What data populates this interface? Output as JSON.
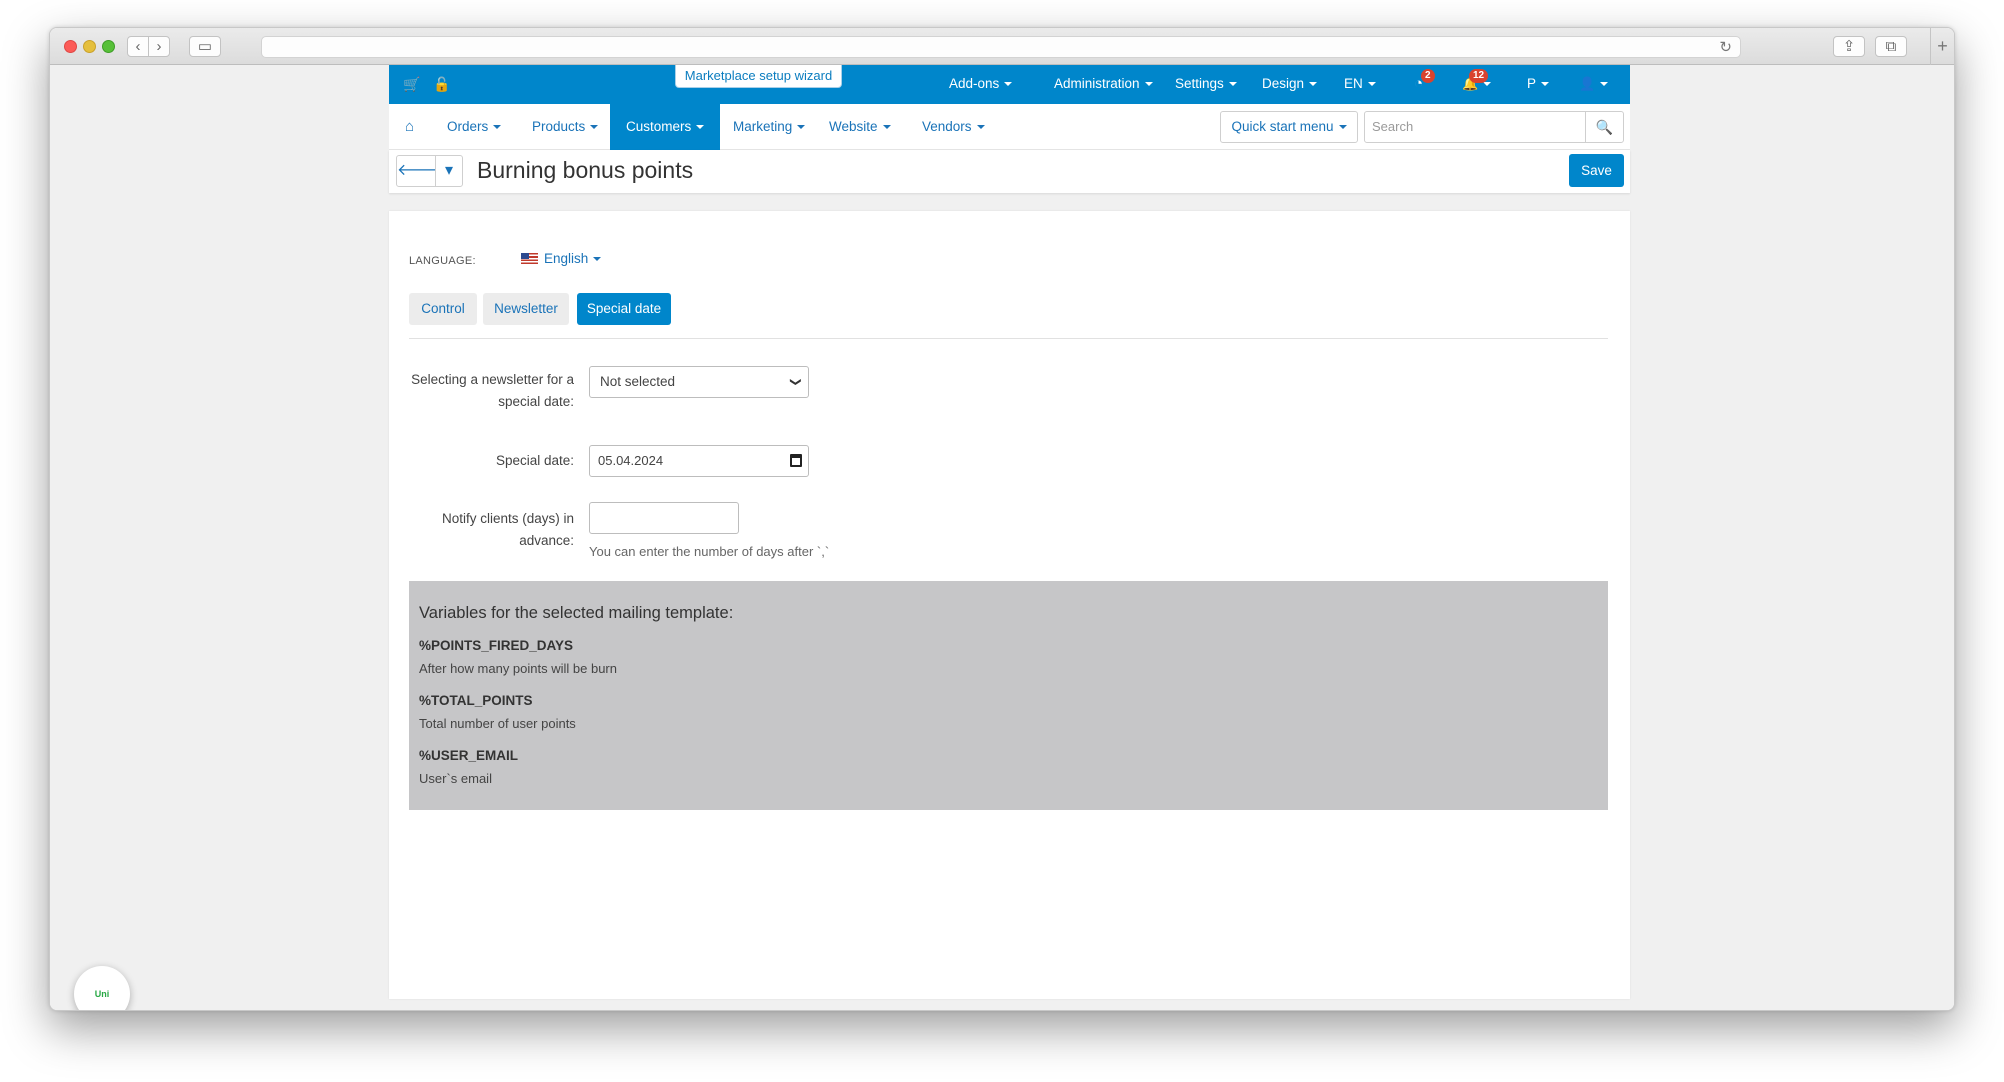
{
  "browser": {
    "back_glyph": "‹",
    "forward_glyph": "›",
    "sidebar_glyph": "▭",
    "reload_glyph": "↻",
    "share_glyph": "⇪",
    "tabs_glyph": "⧉",
    "newtab_glyph": "+"
  },
  "topbar": {
    "icons": [
      "cart-icon",
      "lock-icon"
    ],
    "cart_glyph": "🛒",
    "lock_glyph": "🔓",
    "wizard_label": "Marketplace setup wizard",
    "menu": [
      "Add-ons",
      "Administration",
      "Settings",
      "Design",
      "EN"
    ],
    "updates_badge": "2",
    "notifications_badge": "12",
    "profile_letter": "P",
    "updates_glyph": "◔",
    "bell_glyph": "🔔",
    "user_glyph": "👤"
  },
  "mainnav": {
    "home_glyph": "⌂",
    "items": [
      "Orders",
      "Products",
      "Customers",
      "Marketing",
      "Website",
      "Vendors"
    ],
    "active": "Customers",
    "quick_start": "Quick start menu",
    "search_placeholder": "Search",
    "search_glyph": "🔍"
  },
  "titlebar": {
    "back_glyph": "🡐",
    "dropdown_glyph": "▾",
    "title": "Burning bonus points",
    "save_label": "Save"
  },
  "language": {
    "label": "LANGUAGE:",
    "value": "English"
  },
  "tabs": [
    "Control",
    "Newsletter",
    "Special date"
  ],
  "active_tab": "Special date",
  "form": {
    "newsletter_label_line1": "Selecting a newsletter for a",
    "newsletter_label_line2": "special date:",
    "newsletter_value": "Not selected",
    "newsletter_chevron": "❯",
    "special_date_label": "Special date:",
    "special_date_value": "05.04.2024",
    "notify_label_line1": "Notify clients (days) in",
    "notify_label_line2": "advance:",
    "notify_value": "",
    "notify_help": "You can enter the number of days after `,`"
  },
  "variables": {
    "title": "Variables for the selected mailing template:",
    "items": [
      {
        "name": "%POINTS_FIRED_DAYS",
        "desc": "After how many points will be burn"
      },
      {
        "name": "%TOTAL_POINTS",
        "desc": "Total number of user points"
      },
      {
        "name": "%USER_EMAIL",
        "desc": "User`s email"
      }
    ]
  },
  "widget": {
    "label": "Uni"
  },
  "colors": {
    "primary": "#0086cb",
    "link": "#1a73b8",
    "badge": "#d9432f",
    "panel": "#c6c6c8"
  }
}
